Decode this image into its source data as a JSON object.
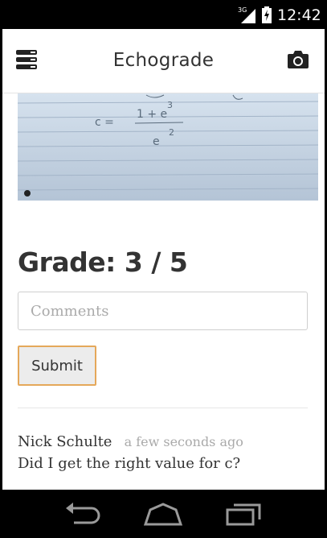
{
  "status_bar": {
    "network": "3G",
    "time": "12:42"
  },
  "app_bar": {
    "title": "Echograde",
    "menu_icon": "menu-icon",
    "camera_icon": "camera-icon"
  },
  "photo": {
    "handwriting_line1": "c =",
    "handwriting_numerator": "1 + e",
    "handwriting_exp_top": "3",
    "handwriting_denominator": "e",
    "handwriting_exp_bottom": "2"
  },
  "grade": {
    "label": "Grade:",
    "score": "3",
    "separator": "/",
    "total": "5"
  },
  "comments_input": {
    "placeholder": "Comments",
    "value": ""
  },
  "submit": {
    "label": "Submit",
    "border_color": "#e5a85a"
  },
  "comments": [
    {
      "author": "Nick Schulte",
      "time": "a few seconds ago",
      "text": "Did I get the right value for c?"
    }
  ],
  "nav_bar": {
    "back_icon": "back-icon",
    "home_icon": "home-icon",
    "recents_icon": "recents-icon"
  }
}
